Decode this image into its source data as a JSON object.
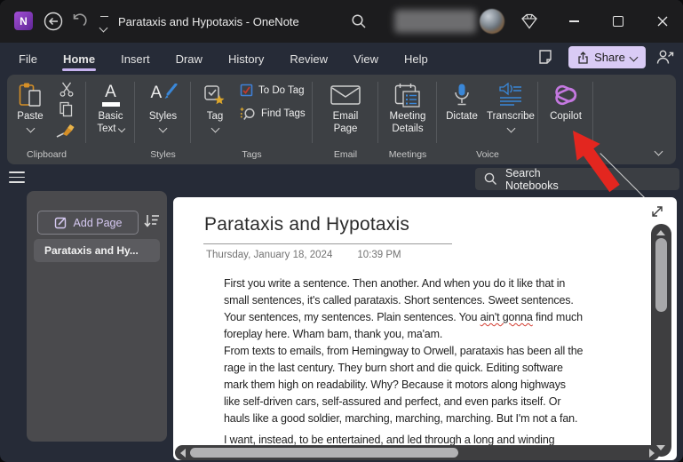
{
  "window": {
    "title": "Parataxis and Hypotaxis - OneNote"
  },
  "menu": {
    "tabs": [
      "File",
      "Home",
      "Insert",
      "Draw",
      "History",
      "Review",
      "View",
      "Help"
    ],
    "active_tab": "Home",
    "share_label": "Share"
  },
  "ribbon": {
    "clipboard": {
      "paste": "Paste",
      "group_label": "Clipboard"
    },
    "basic_text": {
      "line1": "Basic",
      "line2": "Text"
    },
    "styles": {
      "button_label": "Styles",
      "group_label": "Styles"
    },
    "tags": {
      "tag": "Tag",
      "todo": "To Do Tag",
      "find": "Find Tags",
      "group_label": "Tags"
    },
    "email": {
      "line1": "Email",
      "line2": "Page",
      "group_label": "Email"
    },
    "meetings": {
      "line1": "Meeting",
      "line2": "Details",
      "group_label": "Meetings"
    },
    "voice": {
      "dictate": "Dictate",
      "transcribe": "Transcribe",
      "group_label": "Voice"
    },
    "copilot": {
      "label": "Copilot"
    }
  },
  "search": {
    "placeholder": "Search Notebooks"
  },
  "sidebar": {
    "add_page_label": "Add Page",
    "pages": [
      {
        "title": "Parataxis and Hy..."
      }
    ]
  },
  "page": {
    "title": "Parataxis and Hypotaxis",
    "date": "Thursday, January 18, 2024",
    "time": "10:39 PM",
    "para1": {
      "l1": "First you write a sentence. Then another. And when you do it like that in",
      "l2": "small sentences, it's called parataxis. Short sentences. Sweet sentences.",
      "l3a": "Your sentences, my sentences. Plain sentences. You ",
      "l3b": "ain't gonna",
      "l3c": " find much",
      "l4": "foreplay here. Wham bam, thank you, ma'am."
    },
    "para2": {
      "l1": "From texts to emails, from Hemingway to Orwell, parataxis has been all the",
      "l2": "rage in the last century. They burn short and die quick. Editing software",
      "l3": "mark them high on readability. Why? Because it motors along highways",
      "l4": "like self-driven cars, self-assured and perfect, and even parks itself. Or",
      "l5": "hauls like a good soldier, marching, marching, marching. But I'm not a fan."
    },
    "para3": {
      "l1": "I want, instead, to be entertained, and led through a long and winding"
    }
  },
  "icons": {
    "onenote-logo": "purple rounded square with N",
    "back-icon": "circled left arrow",
    "undo-icon": "curved counterclockwise arrow",
    "search-icon": "magnifier",
    "premium-icon": "gem diamond outline",
    "share-icon": "box with up arrow",
    "copilot-icon": "two overlapping purple rounded loops",
    "red-arrow": "annotation arrow pointing at Copilot"
  },
  "colors": {
    "accent_lavender": "#d9cbf5",
    "copilot_purple": "#c478e0",
    "arrow_red": "#e3261f",
    "icon_blue": "#3a87d8",
    "star_gold": "#dca62b",
    "clipboard_orange": "#d58f27",
    "todo_check_red": "#c2392e",
    "onenote_purple": "#7a2daa"
  }
}
